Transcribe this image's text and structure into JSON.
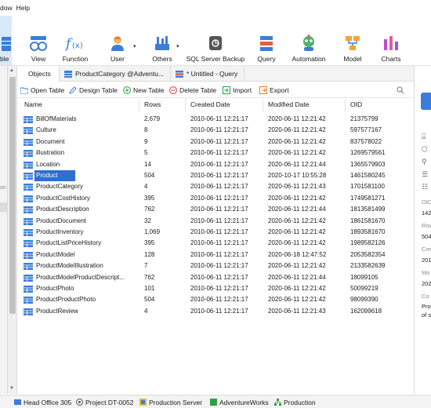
{
  "menu": {
    "items": [
      "dow",
      "Help"
    ]
  },
  "ribbon": {
    "active_cut_label": "ble",
    "buttons": [
      {
        "label": "View"
      },
      {
        "label": "Function"
      },
      {
        "label": "User"
      },
      {
        "label": "Others"
      },
      {
        "label": "SQL Server Backup"
      },
      {
        "label": "Query"
      },
      {
        "label": "Automation"
      },
      {
        "label": "Model"
      },
      {
        "label": "Charts"
      }
    ]
  },
  "leftpanel": {
    "cut_text": "on"
  },
  "tabs": [
    {
      "label": "Objects"
    },
    {
      "label": "ProductCategory @Adventu..."
    },
    {
      "label": "* Untitled - Query"
    }
  ],
  "toolbar": {
    "open_table": "Open Table",
    "design_table": "Design Table",
    "new_table": "New Table",
    "delete_table": "Delete Table",
    "import": "Import",
    "export": "Export"
  },
  "table": {
    "columns": [
      "Name",
      "Rows",
      "Created Date",
      "Modified Date",
      "OID"
    ],
    "rows": [
      {
        "name": "BillOfMaterials",
        "rows": "2,679",
        "created": "2010-06-11 12:21:17",
        "modified": "2020-06-11 12:21:42",
        "oid": "21375799"
      },
      {
        "name": "Culture",
        "rows": "8",
        "created": "2010-06-11 12:21:17",
        "modified": "2020-06-11 12:21:42",
        "oid": "597577167"
      },
      {
        "name": "Document",
        "rows": "9",
        "created": "2010-06-11 12:21:17",
        "modified": "2020-06-11 12:21:42",
        "oid": "837578022"
      },
      {
        "name": "illustration",
        "rows": "5",
        "created": "2010-06-11 12:21:17",
        "modified": "2020-06-11 12:21:42",
        "oid": "1269579561"
      },
      {
        "name": "Location",
        "rows": "14",
        "created": "2010-06-11 12:21:17",
        "modified": "2020-06-11 12:21:44",
        "oid": "1365579903"
      },
      {
        "name": "Product",
        "rows": "504",
        "created": "2010-06-11 12:21:17",
        "modified": "2020-10-17 10:55:28",
        "oid": "1461580245",
        "selected": true
      },
      {
        "name": "ProductCategory",
        "rows": "4",
        "created": "2010-06-11 12:21:17",
        "modified": "2020-06-11 12:21:43",
        "oid": "1701581100"
      },
      {
        "name": "ProductCostHistory",
        "rows": "395",
        "created": "2010-06-11 12:21:17",
        "modified": "2020-06-11 12:21:42",
        "oid": "1749581271"
      },
      {
        "name": "ProductDescription",
        "rows": "762",
        "created": "2010-06-11 12:21:17",
        "modified": "2020-06-11 12:21:44",
        "oid": "1813581499"
      },
      {
        "name": "ProductDocument",
        "rows": "32",
        "created": "2010-06-11 12:21:17",
        "modified": "2020-06-11 12:21:42",
        "oid": "1861581670"
      },
      {
        "name": "ProductInventory",
        "rows": "1,069",
        "created": "2010-06-11 12:21:17",
        "modified": "2020-06-11 12:21:42",
        "oid": "1893581670"
      },
      {
        "name": "ProductListPriceHistory",
        "rows": "395",
        "created": "2010-06-11 12:21:17",
        "modified": "2020-06-11 12:21:42",
        "oid": "1989582126"
      },
      {
        "name": "ProductModel",
        "rows": "128",
        "created": "2010-06-11 12:21:17",
        "modified": "2020-06-18 12:47:52",
        "oid": "2053582354"
      },
      {
        "name": "ProductModelIllustration",
        "rows": "7",
        "created": "2010-06-11 12:21:17",
        "modified": "2020-06-11 12:21:42",
        "oid": "2133582639"
      },
      {
        "name": "ProductModelProductDescript...",
        "rows": "762",
        "created": "2010-06-11 12:21:17",
        "modified": "2020-06-11 12:21:44",
        "oid": "18099105"
      },
      {
        "name": "ProductPhoto",
        "rows": "101",
        "created": "2010-06-11 12:21:17",
        "modified": "2020-06-11 12:21:42",
        "oid": "50099219"
      },
      {
        "name": "ProductProductPhoto",
        "rows": "504",
        "created": "2010-06-11 12:21:17",
        "modified": "2020-06-11 12:21:42",
        "oid": "98099390"
      },
      {
        "name": "ProductReview",
        "rows": "4",
        "created": "2010-06-11 12:21:17",
        "modified": "2020-06-11 12:21:43",
        "oid": "162099618"
      }
    ]
  },
  "rightpanel": {
    "oid_label": "OID",
    "oid_value": "142",
    "rows_label": "Row",
    "rows_value": "504",
    "created_label": "Cre",
    "created_value": "201",
    "modified_label": "Mo",
    "modified_value": "202",
    "comment_label": "Co",
    "comment_value_1": "Pro",
    "comment_value_2": "of s"
  },
  "statusbar": [
    {
      "label": "Head Office 305"
    },
    {
      "label": "Project DT-0052"
    },
    {
      "label": "Production Server"
    },
    {
      "label": "AdventureWorks"
    },
    {
      "label": "Production"
    }
  ],
  "colors": {
    "accent": "#2f6fd0",
    "ribbon_active": "#d9e9fb",
    "table_icon": "#3b7dd8"
  }
}
